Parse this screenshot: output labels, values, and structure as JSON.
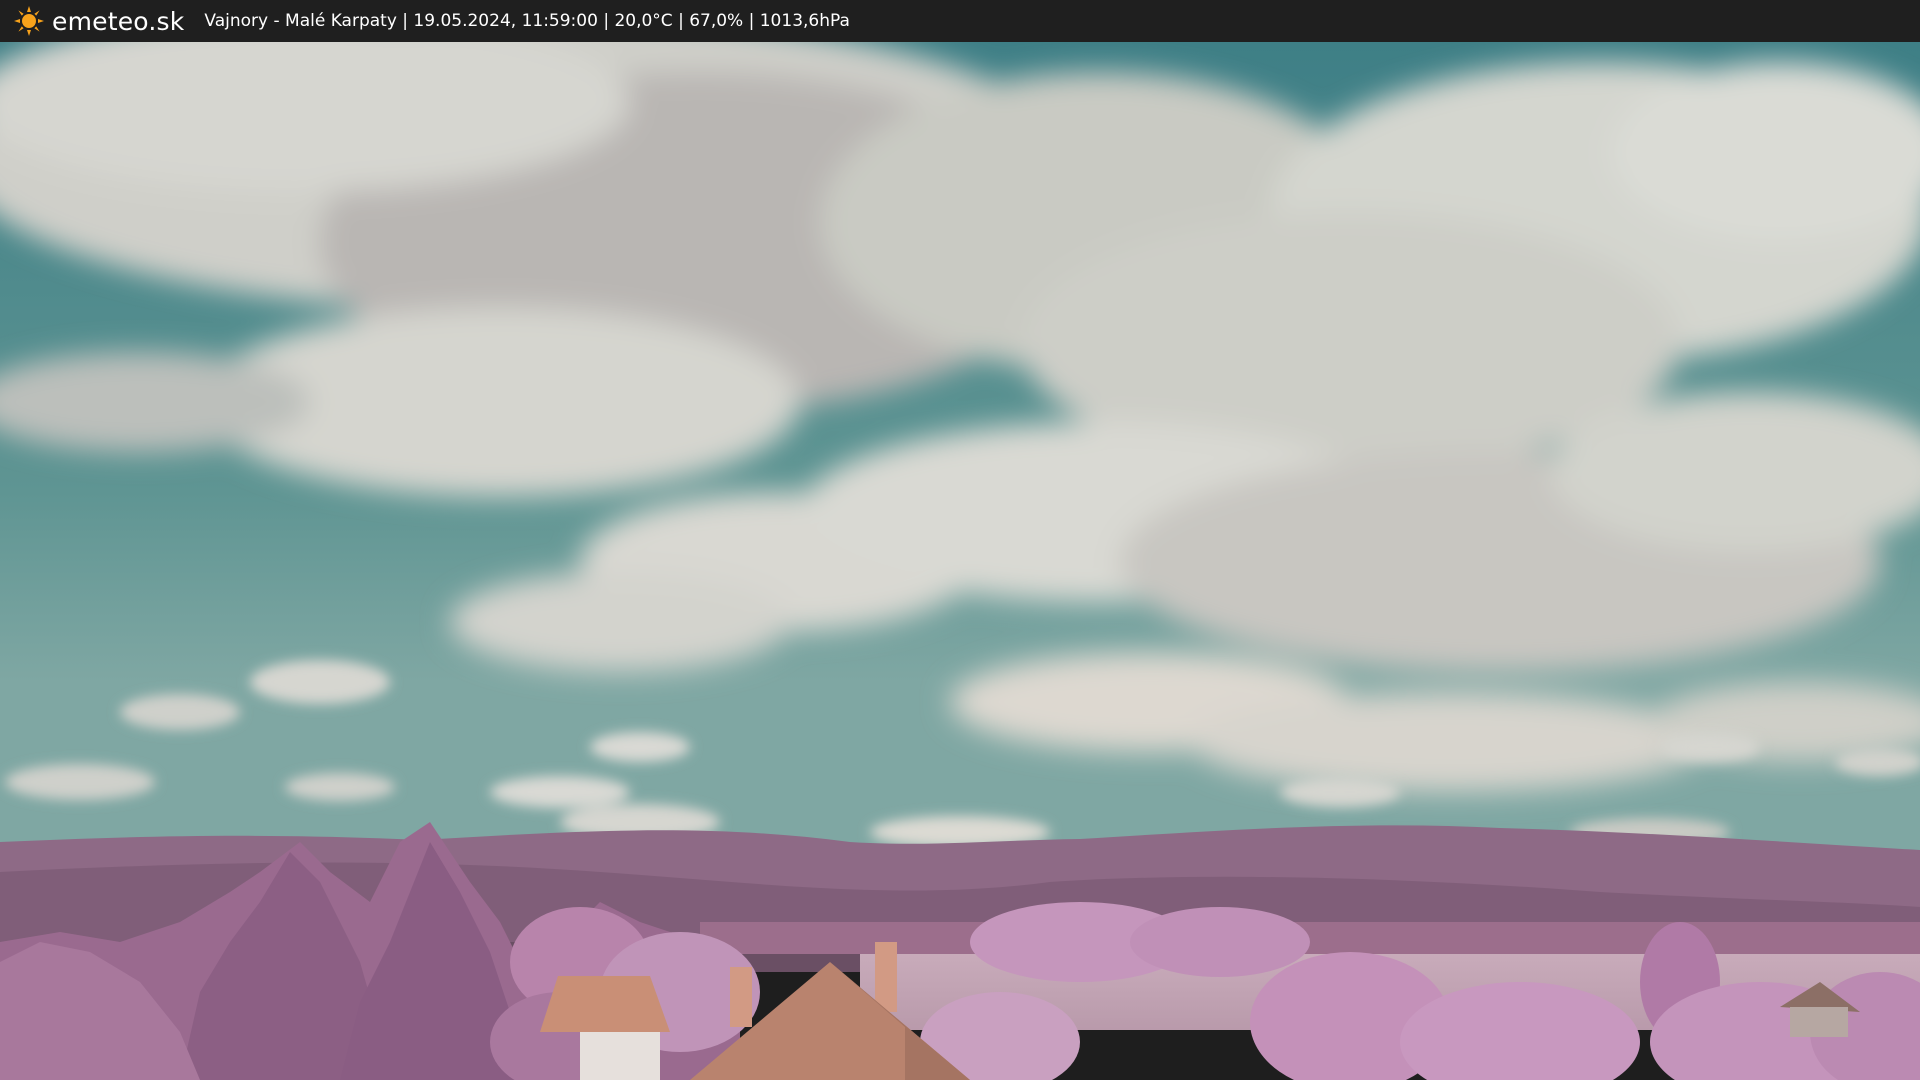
{
  "header": {
    "brand": "emeteo.sk",
    "brand_icon": "sun-icon",
    "caption": "Vajnory - Malé Karpaty | 19.05.2024, 11:59:00 | 20,0°C | 67,0% | 1013,6hPa"
  },
  "colors": {
    "bar_background": "#1f1f1f",
    "sun": "#f7a21b",
    "sky": "#5f9593",
    "cloud": "#d8d8d2",
    "foliage": "#b07aa6",
    "hills": "#8e6a86",
    "roof": "#c98f76"
  }
}
